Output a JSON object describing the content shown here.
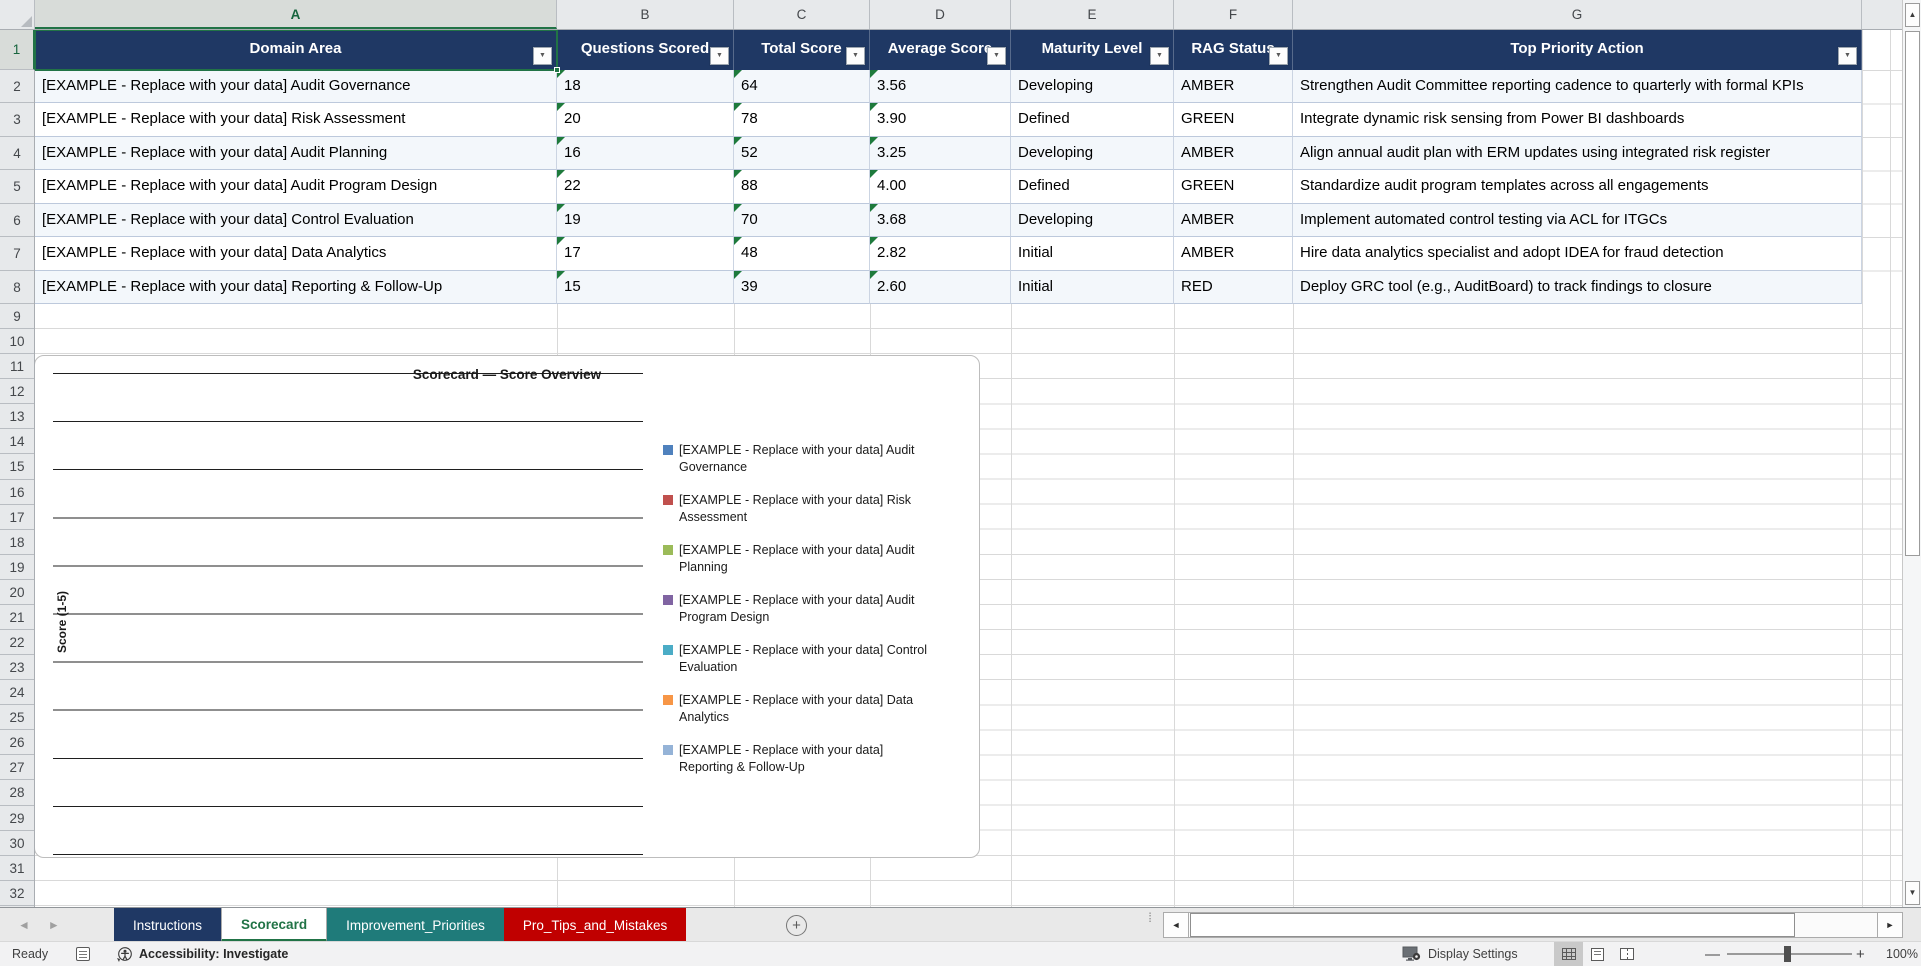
{
  "grid": {
    "column_letters": [
      "A",
      "B",
      "C",
      "D",
      "E",
      "F",
      "G"
    ],
    "selected_cell": "A1",
    "row_selected": "1",
    "rows_tall": [
      "2",
      "3",
      "4",
      "5",
      "6",
      "7",
      "8"
    ],
    "rows_small": [
      "9",
      "10",
      "11",
      "12",
      "13",
      "14",
      "15",
      "16",
      "17",
      "18",
      "19",
      "20",
      "21",
      "22",
      "23",
      "24",
      "25",
      "26",
      "27",
      "28",
      "29",
      "30",
      "31",
      "32"
    ]
  },
  "table": {
    "headers": [
      "Domain Area",
      "Questions Scored",
      "Total Score",
      "Average Score",
      "Maturity Level",
      "RAG Status",
      "Top Priority Action"
    ],
    "rows": [
      {
        "band": true,
        "cells": [
          "[EXAMPLE - Replace with your data] Audit Governance",
          "18",
          "64",
          "3.56",
          "Developing",
          "AMBER",
          "Strengthen Audit Committee reporting cadence to quarterly with formal KPIs"
        ]
      },
      {
        "band": false,
        "cells": [
          "[EXAMPLE - Replace with your data] Risk Assessment",
          "20",
          "78",
          "3.90",
          "Defined",
          "GREEN",
          "Integrate dynamic risk sensing from Power BI dashboards"
        ]
      },
      {
        "band": true,
        "cells": [
          "[EXAMPLE - Replace with your data] Audit Planning",
          "16",
          "52",
          "3.25",
          "Developing",
          "AMBER",
          "Align annual audit plan with ERM updates using integrated risk register"
        ]
      },
      {
        "band": false,
        "cells": [
          "[EXAMPLE - Replace with your data] Audit Program Design",
          "22",
          "88",
          "4.00",
          "Defined",
          "GREEN",
          "Standardize audit program templates across all engagements"
        ]
      },
      {
        "band": true,
        "cells": [
          "[EXAMPLE - Replace with your data] Control Evaluation",
          "19",
          "70",
          "3.68",
          "Developing",
          "AMBER",
          "Implement automated control testing via ACL for ITGCs"
        ]
      },
      {
        "band": false,
        "cells": [
          "[EXAMPLE - Replace with your data] Data Analytics",
          "17",
          "48",
          "2.82",
          "Initial",
          "AMBER",
          "Hire data analytics specialist and adopt IDEA for fraud detection"
        ]
      },
      {
        "band": true,
        "cells": [
          "[EXAMPLE - Replace with your data] Reporting & Follow-Up",
          "15",
          "39",
          "2.60",
          "Initial",
          "RED",
          "Deploy GRC tool (e.g., AuditBoard) to track findings to closure"
        ]
      }
    ]
  },
  "chart": {
    "title": "Scorecard — Score Overview",
    "y_axis_label": "Score (1-5)",
    "legend": [
      {
        "label": "[EXAMPLE - Replace with your data] Audit Governance",
        "color": "#4F81BD"
      },
      {
        "label": "[EXAMPLE - Replace with your data] Risk Assessment",
        "color": "#C0504D"
      },
      {
        "label": "[EXAMPLE - Replace with your data] Audit Planning",
        "color": "#9BBB59"
      },
      {
        "label": "[EXAMPLE - Replace with your data] Audit Program Design",
        "color": "#8064A2"
      },
      {
        "label": "[EXAMPLE - Replace with your data] Control Evaluation",
        "color": "#4BACC6"
      },
      {
        "label": "[EXAMPLE - Replace with your data] Data Analytics",
        "color": "#F79646"
      },
      {
        "label": "[EXAMPLE - Replace with your data] Reporting & Follow-Up",
        "color": "#95B3D7"
      }
    ]
  },
  "chart_data": {
    "type": "bar",
    "title": "Scorecard — Score Overview",
    "ylabel": "Score (1-5)",
    "ylim": [
      0,
      5
    ],
    "gridline_step": 0.5,
    "grid": true,
    "legend_position": "right",
    "bars_visible": false,
    "series": [
      {
        "name": "[EXAMPLE - Replace with your data] Audit Governance",
        "color": "#4F81BD"
      },
      {
        "name": "[EXAMPLE - Replace with your data] Risk Assessment",
        "color": "#C0504D"
      },
      {
        "name": "[EXAMPLE - Replace with your data] Audit Planning",
        "color": "#9BBB59"
      },
      {
        "name": "[EXAMPLE - Replace with your data] Audit Program Design",
        "color": "#8064A2"
      },
      {
        "name": "[EXAMPLE - Replace with your data] Control Evaluation",
        "color": "#4BACC6"
      },
      {
        "name": "[EXAMPLE - Replace with your data] Data Analytics",
        "color": "#F79646"
      },
      {
        "name": "[EXAMPLE - Replace with your data] Reporting & Follow-Up",
        "color": "#95B3D7"
      }
    ]
  },
  "sheet_tabs": [
    {
      "label": "Instructions",
      "bg": "#1F3864",
      "fg": "#FFFFFF",
      "active": false
    },
    {
      "label": "Scorecard",
      "bg": "#FFFFFF",
      "fg": "#217346",
      "active": true
    },
    {
      "label": "Improvement_Priorities",
      "bg": "#1F7B7A",
      "fg": "#FFFFFF",
      "active": false
    },
    {
      "label": "Pro_Tips_and_Mistakes",
      "bg": "#C00000",
      "fg": "#FFFFFF",
      "active": false
    }
  ],
  "status_bar": {
    "ready": "Ready",
    "accessibility": "Accessibility: Investigate",
    "display_settings": "Display Settings",
    "zoom_level": "100%"
  },
  "icons": {
    "filter": "▼",
    "scroll_up": "▲",
    "scroll_down": "▼",
    "scroll_left": "◄",
    "scroll_right": "►",
    "tab_prev": "◄",
    "tab_next": "►",
    "add_sheet": "+",
    "dots_handle": "⁞",
    "zoom_out": "—",
    "zoom_in": "+"
  }
}
